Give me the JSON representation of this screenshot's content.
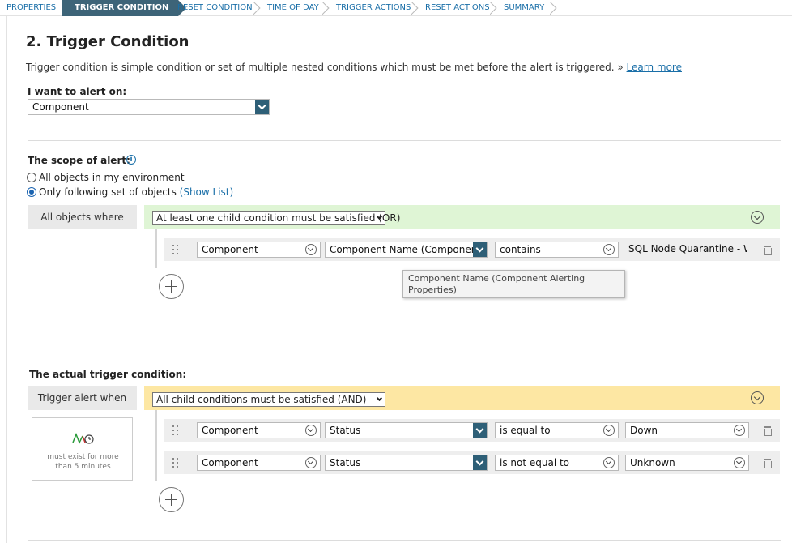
{
  "breadcrumb": {
    "properties": "PROPERTIES",
    "trigger_condition": "TRIGGER CONDITION",
    "reset_condition": "RESET CONDITION",
    "time_of_day": "TIME OF DAY",
    "trigger_actions": "TRIGGER ACTIONS",
    "reset_actions": "RESET ACTIONS",
    "summary": "SUMMARY"
  },
  "page": {
    "title": "2. Trigger Condition",
    "description": "Trigger condition is simple condition or set of multiple nested conditions which must be met before the alert is triggered. »",
    "learn_more": "Learn more"
  },
  "alert_on": {
    "label": "I want to alert on:",
    "value": "Component"
  },
  "scope": {
    "label": "The scope of alert:",
    "info_icon": "i",
    "option_all": "All objects in my environment",
    "option_following": "Only following set of objects",
    "show_list": "(Show List)",
    "selected": "option_following",
    "where_label": "All objects where",
    "group_mode": "At least one child condition must be satisfied (OR)",
    "condition": {
      "object": "Component",
      "field": "Component Name (Component Alerting Properties)",
      "operator": "contains",
      "value": "SQL Node Quarantine - Windows"
    },
    "tooltip": "Component Name (Component Alerting Properties)"
  },
  "trigger": {
    "label": "The actual trigger condition:",
    "when_label": "Trigger alert when",
    "group_mode": "All child conditions must be satisfied (AND)",
    "conditions": [
      {
        "object": "Component",
        "field": "Status",
        "operator": "is equal to",
        "value": "Down"
      },
      {
        "object": "Component",
        "field": "Status",
        "operator": "is not equal to",
        "value": "Unknown"
      }
    ],
    "must_exist": "must exist for more",
    "must_exist_2": "than 5 minutes"
  },
  "colors": {
    "accent": "#2e5f77",
    "link": "#1a6fa8",
    "or_band": "#dff5d5",
    "and_band": "#fde7a3"
  }
}
